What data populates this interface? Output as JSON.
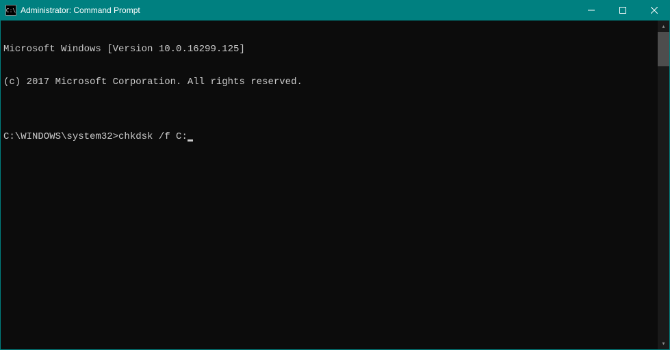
{
  "window": {
    "title": "Administrator: Command Prompt",
    "icon_label": "C:\\"
  },
  "console": {
    "line1": "Microsoft Windows [Version 10.0.16299.125]",
    "line2": "(c) 2017 Microsoft Corporation. All rights reserved.",
    "blank": "",
    "prompt": "C:\\WINDOWS\\system32>",
    "command": "chkdsk /f C:"
  },
  "scrollbar": {
    "up_glyph": "▴",
    "down_glyph": "▾"
  }
}
